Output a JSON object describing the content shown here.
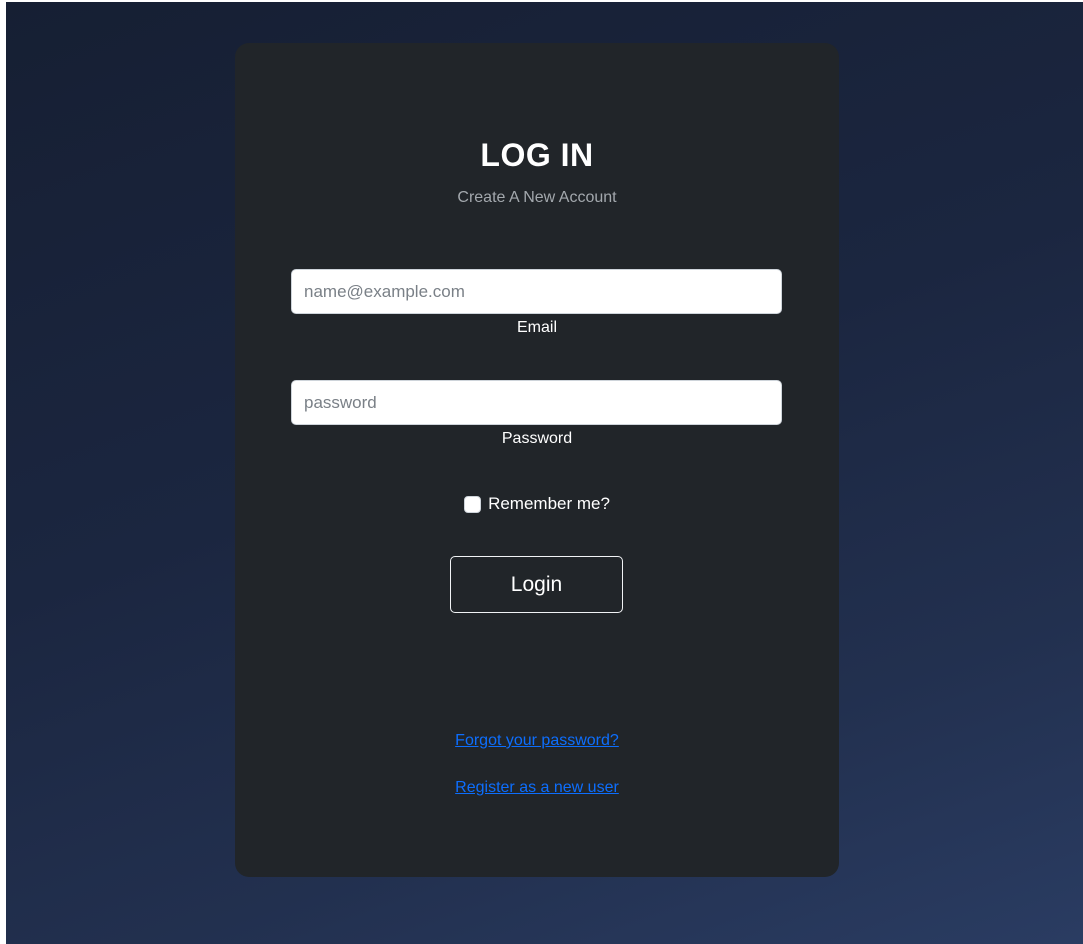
{
  "login_card": {
    "title": "LOG IN",
    "subtitle": "Create A New Account",
    "email": {
      "placeholder": "name@example.com",
      "value": "",
      "label": "Email"
    },
    "password": {
      "placeholder": "password",
      "value": "",
      "label": "Password"
    },
    "remember_me": {
      "label": "Remember me?",
      "checked": false
    },
    "login_button_label": "Login",
    "links": {
      "forgot_password": "Forgot your password?",
      "register": "Register as a new user"
    }
  },
  "colors": {
    "card_background": "#212529",
    "page_gradient_start": "#161f33",
    "page_gradient_end": "#2a3c62",
    "link": "#0d6efd",
    "subtitle": "#a3a8ad"
  }
}
